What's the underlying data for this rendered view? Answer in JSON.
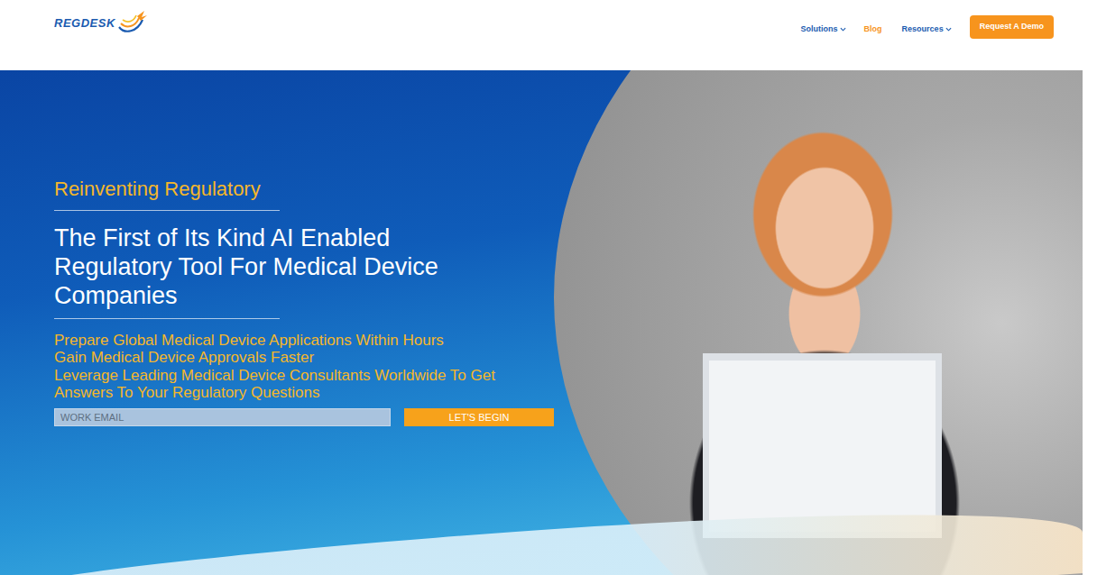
{
  "logo": {
    "text": "REGDESK"
  },
  "nav": {
    "items": [
      {
        "label": "Solutions",
        "dropdown": true,
        "selected": false
      },
      {
        "label": "Blog",
        "dropdown": false,
        "selected": true
      },
      {
        "label": "Resources",
        "dropdown": true,
        "selected": false
      }
    ],
    "cta": "Request A Demo"
  },
  "hero": {
    "eyebrow": "Reinventing Regulatory",
    "title": "The First of Its Kind AI Enabled Regulatory Tool For Medical Device Companies",
    "points": [
      "Prepare Global Medical Device Applications Within Hours",
      "Gain Medical Device Approvals Faster",
      "Leverage Leading Medical Device Consultants Worldwide To Get Answers To Your Regulatory Questions"
    ],
    "email_placeholder": "WORK EMAIL",
    "submit": "LET'S BEGIN"
  }
}
